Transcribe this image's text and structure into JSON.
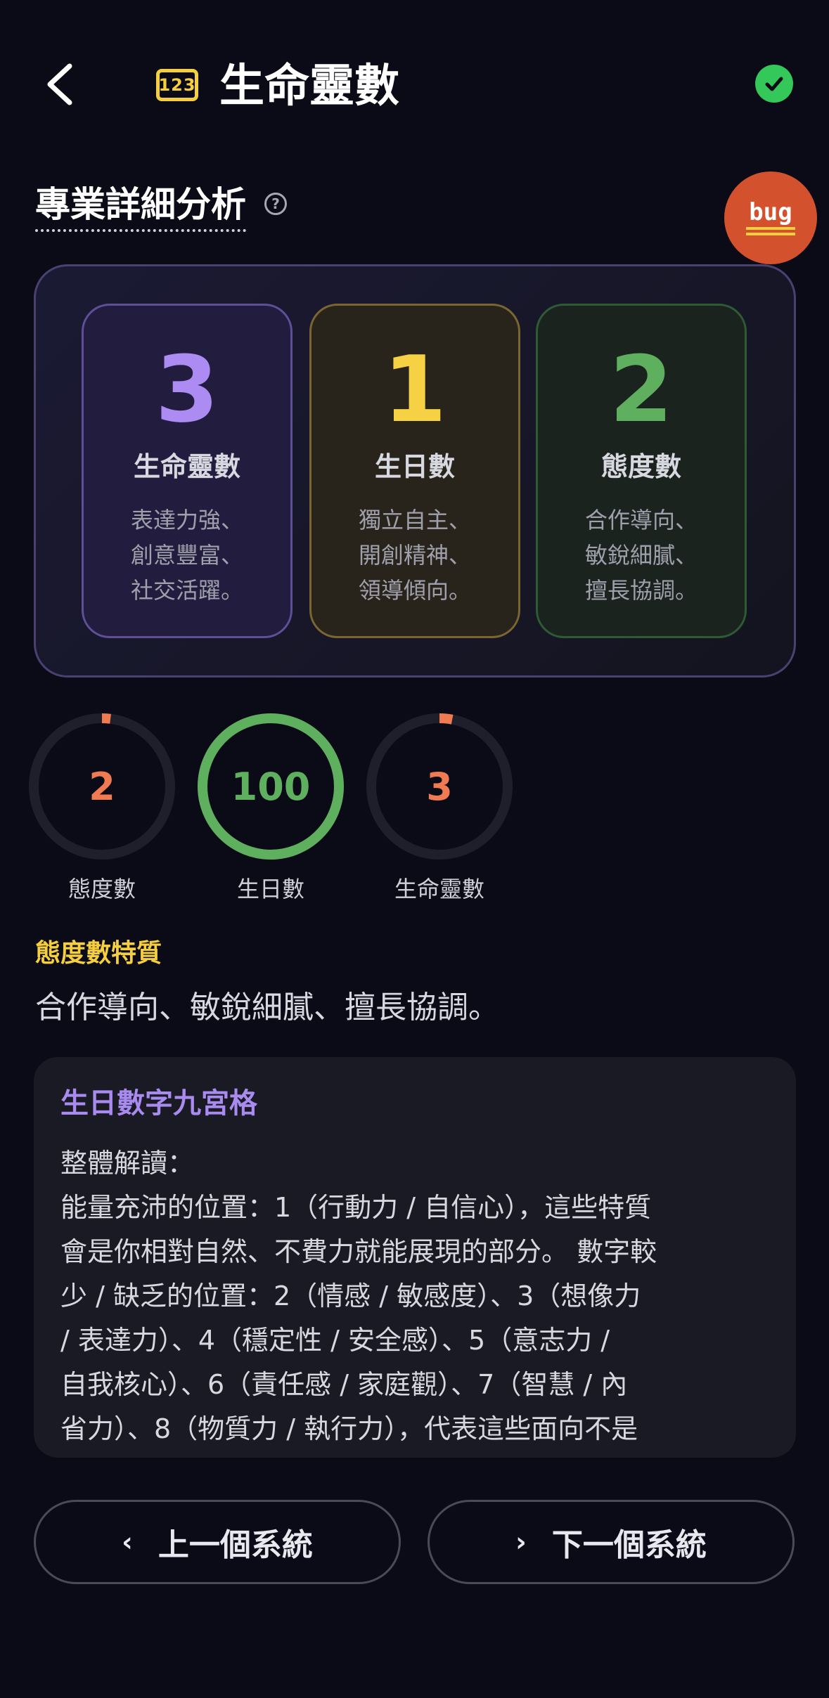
{
  "header": {
    "title": "生命靈數",
    "icon_text": "123"
  },
  "section": {
    "title": "專業詳細分析",
    "help": "?",
    "bug_label": "bug"
  },
  "cards": [
    {
      "number": "3",
      "label": "生命靈數",
      "desc": "表達力強、\n創意豐富、\n社交活躍。"
    },
    {
      "number": "1",
      "label": "生日數",
      "desc": "獨立自主、\n開創精神、\n領導傾向。"
    },
    {
      "number": "2",
      "label": "態度數",
      "desc": "合作導向、\n敏銳細膩、\n擅長協調。"
    }
  ],
  "rings": [
    {
      "value": "2",
      "label": "態度數",
      "fraction": 0.02,
      "color": "#f07a52"
    },
    {
      "value": "100",
      "label": "生日數",
      "fraction": 1.0,
      "color": "#5fb05e"
    },
    {
      "value": "3",
      "label": "生命靈數",
      "fraction": 0.03,
      "color": "#f07a52"
    }
  ],
  "trait": {
    "title": "態度數特質",
    "text": "合作導向、敏銳細膩、擅長協調。"
  },
  "grid": {
    "title": "生日數字九宮格",
    "body": "整體解讀：\n能量充沛的位置：1（行動力 / 自信心），這些特質\n會是你相對自然、不費力就能展現的部分。 數字較\n少 / 缺乏的位置：2（情感 / 敏感度）、3（想像力\n / 表達力）、4（穩定性 / 安全感）、5（意志力 /\n自我核心）、6（責任感 / 家庭觀）、7（智慧 / 內\n省力）、8（物質力 / 執行力），代表這些面向不是\n"
  },
  "nav": {
    "prev": "上一個系統",
    "next": "下一個系統"
  }
}
